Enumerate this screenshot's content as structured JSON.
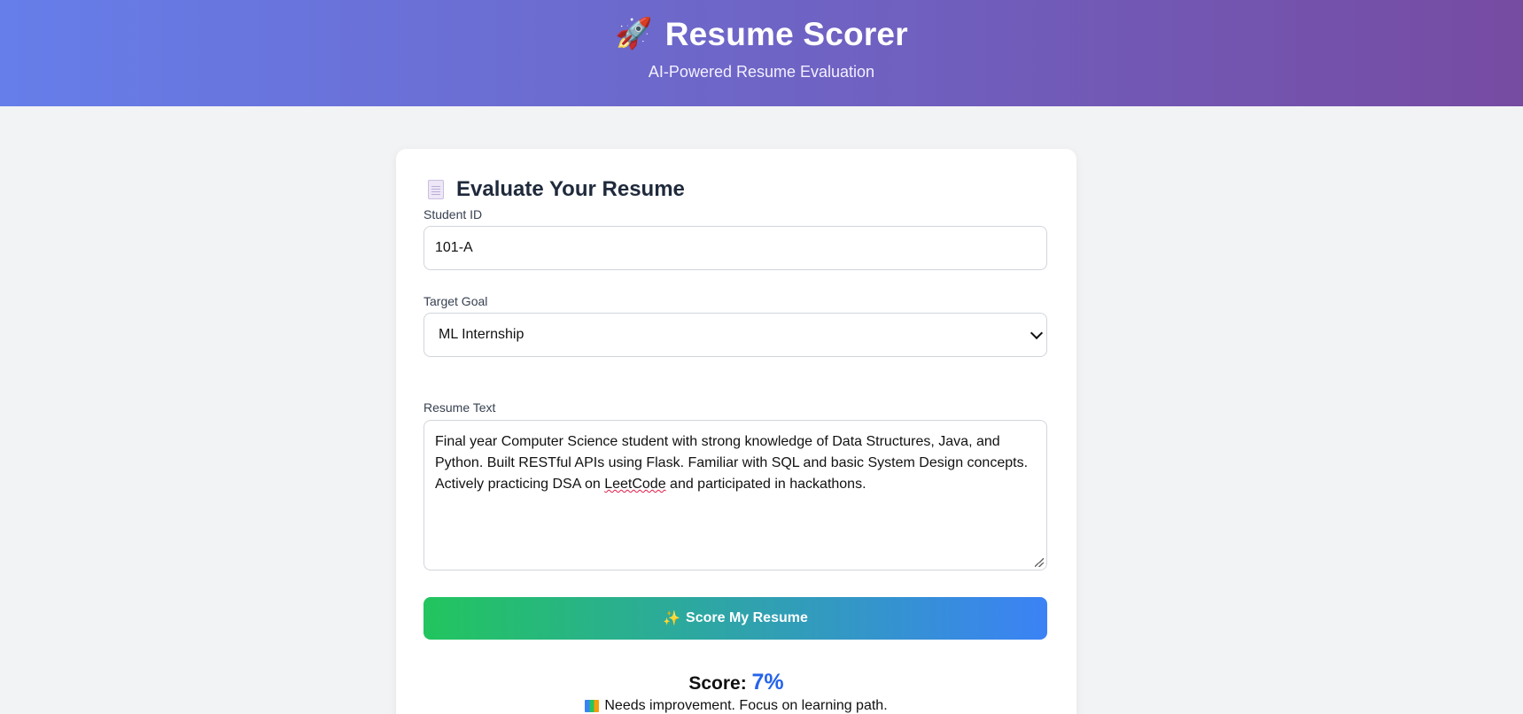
{
  "header": {
    "title": "Resume Scorer",
    "subtitle": "AI-Powered Resume Evaluation",
    "icon": "rocket-icon",
    "gradient": [
      "#667eea",
      "#764ba2"
    ]
  },
  "form": {
    "title": "Evaluate Your Resume",
    "icon": "document-icon",
    "student_id": {
      "label": "Student ID",
      "value": "101-A"
    },
    "target_goal": {
      "label": "Target Goal",
      "value": "ML Internship"
    },
    "resume_text": {
      "label": "Resume Text",
      "value_before": "Final year Computer Science student with strong knowledge of Data Structures, Java, and Python. Built RESTful APIs using Flask. Familiar with SQL and basic System Design concepts. Actively practicing DSA on ",
      "value_misspelled": "LeetCode",
      "value_after": " and participated in hackathons."
    },
    "submit_label": "Score My Resume",
    "submit_icon": "sparkles-icon",
    "submit_gradient": [
      "#22c55e",
      "#3b82f6"
    ]
  },
  "result": {
    "score_label": "Score:",
    "score_value": "7%",
    "feedback_icon": "books-icon",
    "feedback": "Needs improvement. Focus on learning path."
  }
}
